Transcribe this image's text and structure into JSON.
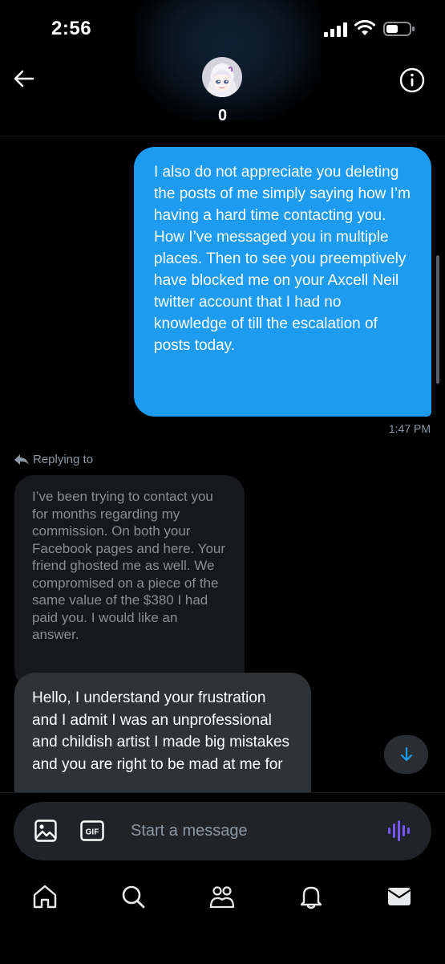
{
  "status_bar": {
    "time": "2:56",
    "icons": [
      "cellular-signal-icon",
      "wifi-icon",
      "battery-icon"
    ]
  },
  "header": {
    "contact_name": "0",
    "back_icon": "arrow-left-icon",
    "info_icon": "info-circle-icon"
  },
  "messages": {
    "sent": {
      "text": "I also do not appreciate you deleting the posts of me simply saying how I’m having a hard time contacting you. How I’ve messaged you in multiple places. Then to see you preemptively have blocked me on your Axcell Neil twitter account that I had no knowledge of till the escalation of posts today.",
      "timestamp": "1:47 PM"
    },
    "reply_label": "Replying to",
    "quoted_text": "I’ve been trying to contact you for months regarding my commission. On both your Facebook pages and here. Your friend ghosted me as well. We compromised on a piece of the same value of the $380 I had paid you. I would like an answer.",
    "received_text": "Hello, I understand your frustration and I admit I was an unprofessional and childish artist I made big mistakes and you are right to be mad at me for"
  },
  "composer": {
    "placeholder": "Start a message",
    "gif_label": "GIF"
  },
  "tabbar": {
    "items": [
      "home-icon",
      "search-icon",
      "communities-icon",
      "notifications-icon",
      "messages-icon"
    ]
  },
  "colors": {
    "accent": "#1d9bf0",
    "voice_accent": "#7856ff"
  }
}
